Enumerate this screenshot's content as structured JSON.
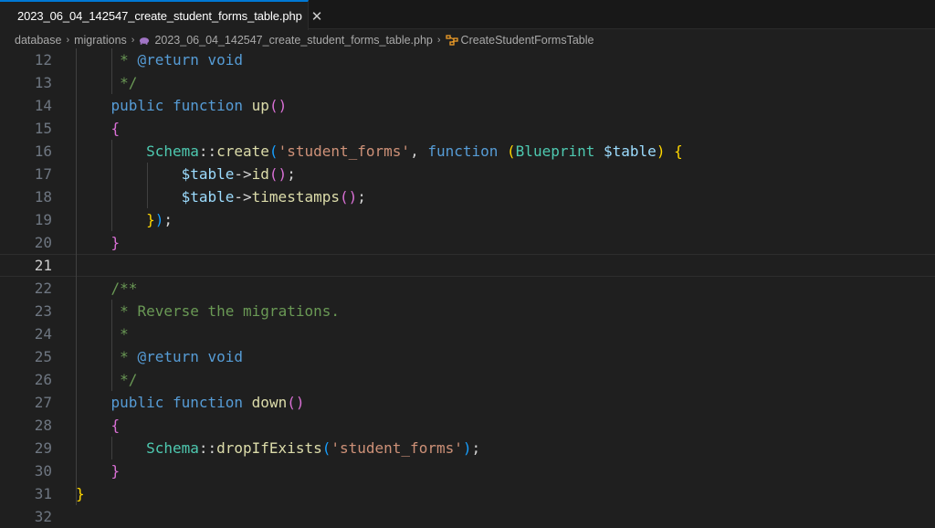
{
  "tab": {
    "filename": "2023_06_04_142547_create_student_forms_table.php",
    "icon": "php-elephant-icon",
    "close_glyph": "✕",
    "accent": "#0078d4"
  },
  "breadcrumb": {
    "items": [
      "database",
      "migrations",
      "2023_06_04_142547_create_student_forms_table.php",
      "CreateStudentFormsTable"
    ],
    "separator": "›"
  },
  "editor": {
    "current_line": 21,
    "lines": [
      {
        "n": "12",
        "tokens": [
          [
            "     ",
            ""
          ],
          [
            "* ",
            "c-comment"
          ],
          [
            "@return",
            "c-tag"
          ],
          [
            " ",
            "c-comment"
          ],
          [
            "void",
            "c-tag"
          ]
        ]
      },
      {
        "n": "13",
        "tokens": [
          [
            "     ",
            ""
          ],
          [
            "*/",
            "c-comment"
          ]
        ]
      },
      {
        "n": "14",
        "tokens": [
          [
            "    ",
            ""
          ],
          [
            "public",
            "c-kw"
          ],
          [
            " ",
            ""
          ],
          [
            "function",
            "c-kw"
          ],
          [
            " ",
            ""
          ],
          [
            "up",
            "c-fn"
          ],
          [
            "()",
            "b2"
          ]
        ]
      },
      {
        "n": "15",
        "tokens": [
          [
            "    ",
            ""
          ],
          [
            "{",
            "b2"
          ]
        ]
      },
      {
        "n": "16",
        "tokens": [
          [
            "        ",
            ""
          ],
          [
            "Schema",
            "c-cls"
          ],
          [
            "::",
            "c-punc"
          ],
          [
            "create",
            "c-fn"
          ],
          [
            "(",
            "b3"
          ],
          [
            "'student_forms'",
            "c-str"
          ],
          [
            ", ",
            "c-punc"
          ],
          [
            "function",
            "c-kw"
          ],
          [
            " ",
            ""
          ],
          [
            "(",
            "b1"
          ],
          [
            "Blueprint",
            "c-cls"
          ],
          [
            " ",
            ""
          ],
          [
            "$table",
            "c-var"
          ],
          [
            ")",
            "b1"
          ],
          [
            " ",
            ""
          ],
          [
            "{",
            "b1"
          ]
        ]
      },
      {
        "n": "17",
        "tokens": [
          [
            "            ",
            ""
          ],
          [
            "$table",
            "c-var"
          ],
          [
            "->",
            "c-punc"
          ],
          [
            "id",
            "c-fn"
          ],
          [
            "()",
            "b2"
          ],
          [
            ";",
            "c-punc"
          ]
        ]
      },
      {
        "n": "18",
        "tokens": [
          [
            "            ",
            ""
          ],
          [
            "$table",
            "c-var"
          ],
          [
            "->",
            "c-punc"
          ],
          [
            "timestamps",
            "c-fn"
          ],
          [
            "()",
            "b2"
          ],
          [
            ";",
            "c-punc"
          ]
        ]
      },
      {
        "n": "19",
        "tokens": [
          [
            "        ",
            ""
          ],
          [
            "}",
            "b1"
          ],
          [
            ")",
            "b3"
          ],
          [
            ";",
            "c-punc"
          ]
        ]
      },
      {
        "n": "20",
        "tokens": [
          [
            "    ",
            ""
          ],
          [
            "}",
            "b2"
          ]
        ]
      },
      {
        "n": "21",
        "tokens": []
      },
      {
        "n": "22",
        "tokens": [
          [
            "    ",
            ""
          ],
          [
            "/**",
            "c-comment"
          ]
        ]
      },
      {
        "n": "23",
        "tokens": [
          [
            "     ",
            ""
          ],
          [
            "* Reverse the migrations.",
            "c-comment"
          ]
        ]
      },
      {
        "n": "24",
        "tokens": [
          [
            "     ",
            ""
          ],
          [
            "*",
            "c-comment"
          ]
        ]
      },
      {
        "n": "25",
        "tokens": [
          [
            "     ",
            ""
          ],
          [
            "* ",
            "c-comment"
          ],
          [
            "@return",
            "c-tag"
          ],
          [
            " ",
            "c-comment"
          ],
          [
            "void",
            "c-tag"
          ]
        ]
      },
      {
        "n": "26",
        "tokens": [
          [
            "     ",
            ""
          ],
          [
            "*/",
            "c-comment"
          ]
        ]
      },
      {
        "n": "27",
        "tokens": [
          [
            "    ",
            ""
          ],
          [
            "public",
            "c-kw"
          ],
          [
            " ",
            ""
          ],
          [
            "function",
            "c-kw"
          ],
          [
            " ",
            ""
          ],
          [
            "down",
            "c-fn"
          ],
          [
            "()",
            "b2"
          ]
        ]
      },
      {
        "n": "28",
        "tokens": [
          [
            "    ",
            ""
          ],
          [
            "{",
            "b2"
          ]
        ]
      },
      {
        "n": "29",
        "tokens": [
          [
            "        ",
            ""
          ],
          [
            "Schema",
            "c-cls"
          ],
          [
            "::",
            "c-punc"
          ],
          [
            "dropIfExists",
            "c-fn"
          ],
          [
            "(",
            "b3"
          ],
          [
            "'student_forms'",
            "c-str"
          ],
          [
            ")",
            "b3"
          ],
          [
            ";",
            "c-punc"
          ]
        ]
      },
      {
        "n": "30",
        "tokens": [
          [
            "    ",
            ""
          ],
          [
            "}",
            "b2"
          ]
        ]
      },
      {
        "n": "31",
        "tokens": [
          [
            "",
            ""
          ],
          [
            "}",
            "b1"
          ]
        ]
      },
      {
        "n": "32",
        "tokens": []
      }
    ]
  }
}
